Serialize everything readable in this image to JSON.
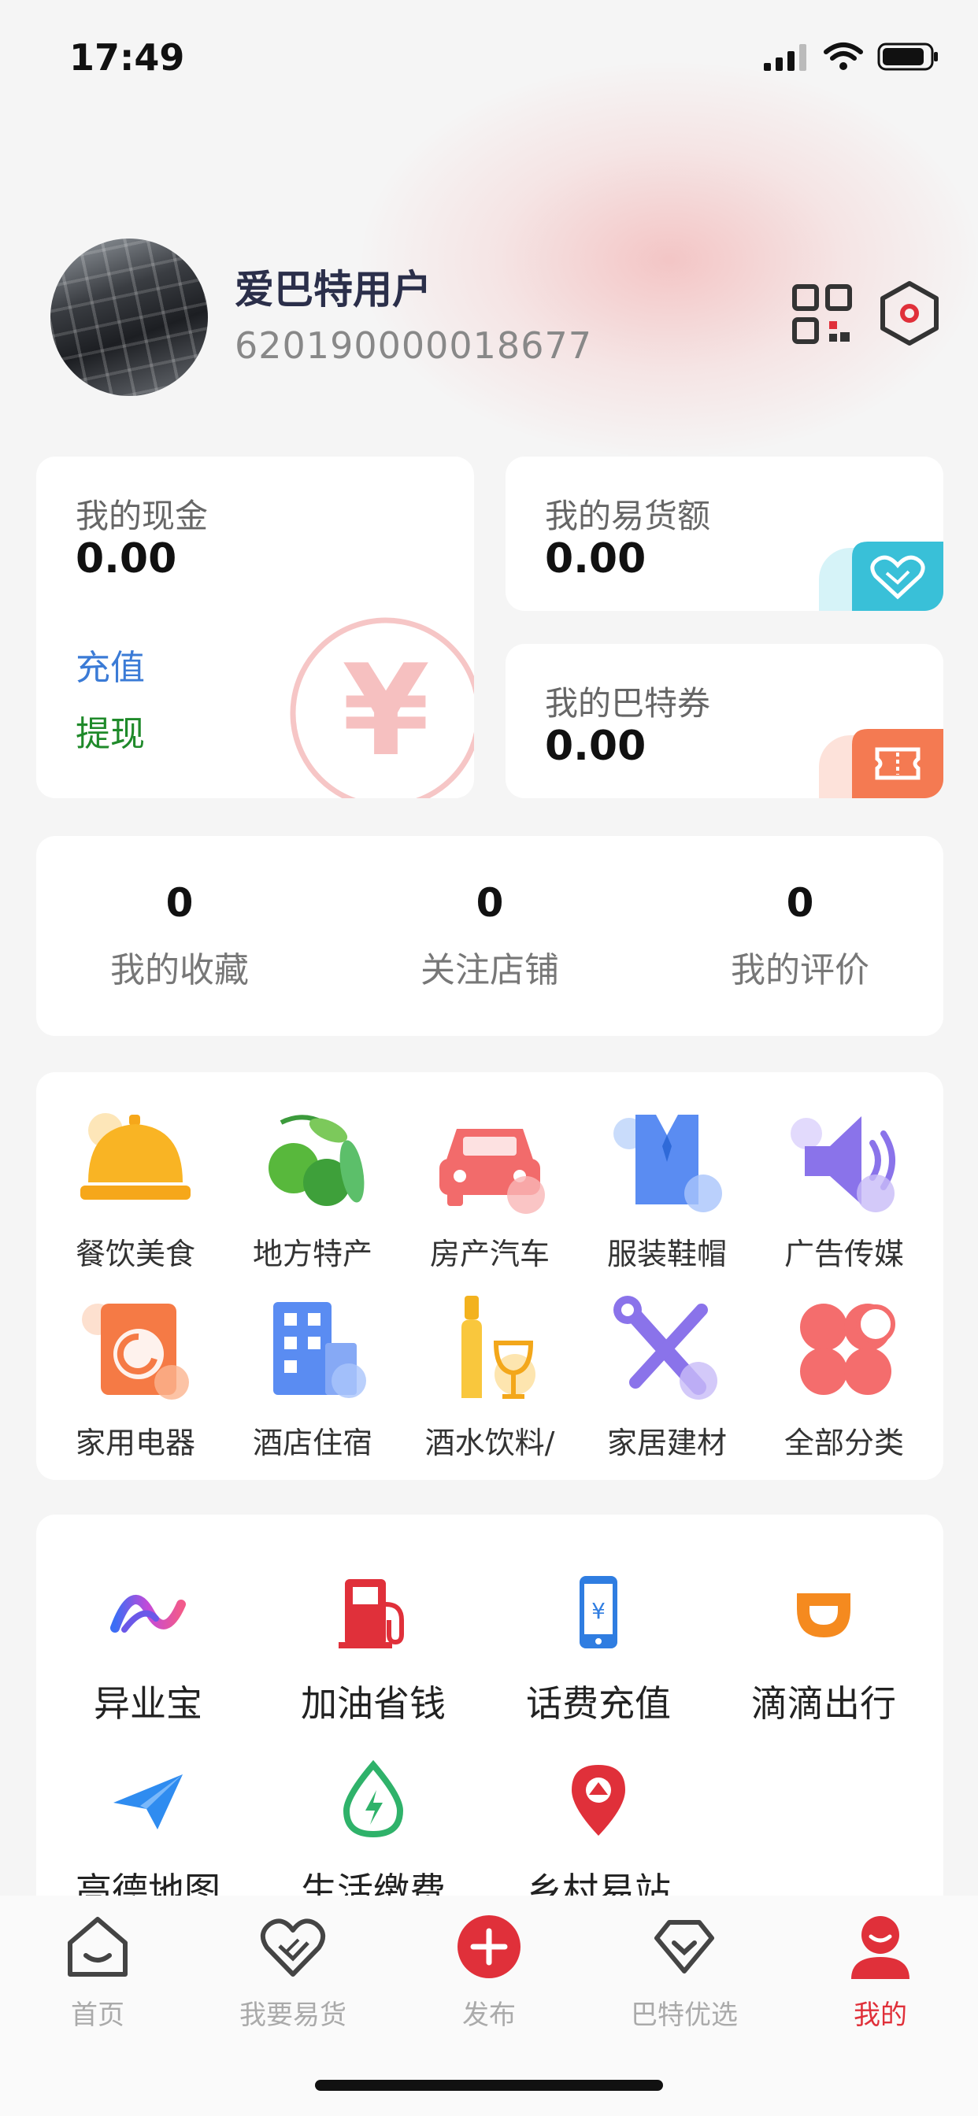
{
  "status_bar": {
    "time": "17:49"
  },
  "profile": {
    "name": "爱巴特用户",
    "id": "620190000018677"
  },
  "wallet": {
    "cash": {
      "title": "我的现金",
      "value": "0.00",
      "recharge": "充值",
      "withdraw": "提现",
      "symbol": "¥"
    },
    "barter_amount": {
      "title": "我的易货额",
      "value": "0.00"
    },
    "coupon": {
      "title": "我的巴特券",
      "value": "0.00"
    }
  },
  "stats": [
    {
      "value": "0",
      "label": "我的收藏"
    },
    {
      "value": "0",
      "label": "关注店铺"
    },
    {
      "value": "0",
      "label": "我的评价"
    }
  ],
  "categories": [
    {
      "label": "餐饮美食",
      "icon": "food-cloche-icon"
    },
    {
      "label": "地方特产",
      "icon": "olive-icon"
    },
    {
      "label": "房产汽车",
      "icon": "car-icon"
    },
    {
      "label": "服装鞋帽",
      "icon": "shirt-icon"
    },
    {
      "label": "广告传媒",
      "icon": "speaker-icon"
    },
    {
      "label": "家用电器",
      "icon": "washing-machine-icon"
    },
    {
      "label": "酒店住宿",
      "icon": "hotel-building-icon"
    },
    {
      "label": "酒水饮料/",
      "icon": "wine-icon"
    },
    {
      "label": "家居建材",
      "icon": "tools-icon"
    },
    {
      "label": "全部分类",
      "icon": "all-categories-icon"
    }
  ],
  "services": [
    {
      "label": "异业宝",
      "icon": "yiyebao-logo-icon"
    },
    {
      "label": "加油省钱",
      "icon": "fuel-pump-icon"
    },
    {
      "label": "话费充值",
      "icon": "phone-recharge-icon"
    },
    {
      "label": "滴滴出行",
      "icon": "didi-icon"
    },
    {
      "label": "高德地图",
      "icon": "paper-plane-icon"
    },
    {
      "label": "生活缴费",
      "icon": "utility-drop-icon"
    },
    {
      "label": "乡村易站",
      "icon": "location-pin-icon"
    }
  ],
  "tabbar": [
    {
      "label": "首页",
      "icon": "home-icon",
      "active": false
    },
    {
      "label": "我要易货",
      "icon": "handshake-heart-icon",
      "active": false
    },
    {
      "label": "发布",
      "icon": "plus-circle-icon",
      "active": false
    },
    {
      "label": "巴特优选",
      "icon": "diamond-icon",
      "active": false
    },
    {
      "label": "我的",
      "icon": "profile-icon",
      "active": true
    }
  ],
  "colors": {
    "accent": "#e0303a",
    "link_blue": "#3b7bd6",
    "link_green": "#1f8a2a",
    "tab_active": "#e0303a",
    "tab_inactive": "#aaaaaa"
  }
}
